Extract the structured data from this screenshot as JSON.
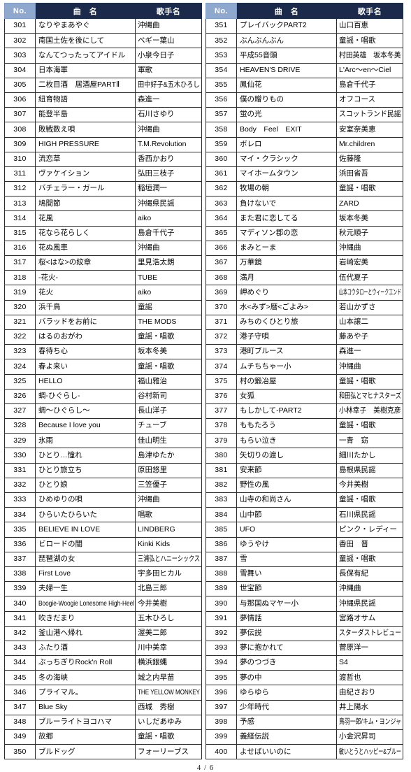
{
  "document": {
    "page_label": "4 / 6",
    "colors": {
      "header_bg": "#1b2a4a",
      "header_no_bg": "#8fa8cd",
      "header_text": "#ffffff",
      "cell_border": "#2b2b2b",
      "page_bg": "#ffffff"
    }
  },
  "tables": [
    {
      "id": "left-table",
      "columns": [
        "No.",
        "曲　名",
        "歌手名"
      ],
      "rows": [
        {
          "no": "301",
          "title": "なりやまあやぐ",
          "artist": "沖縄曲"
        },
        {
          "no": "302",
          "title": "南国土佐を後にして",
          "artist": "ペギー葉山"
        },
        {
          "no": "303",
          "title": "なんてつったってアイドル",
          "artist": "小泉今日子"
        },
        {
          "no": "304",
          "title": "日本海軍",
          "artist": "軍歌"
        },
        {
          "no": "305",
          "title": "二枚目酒　居酒屋PARTⅡ",
          "artist": "田中好子&五木ひろし"
        },
        {
          "no": "306",
          "title": "紐育物語",
          "artist": "森進一"
        },
        {
          "no": "307",
          "title": "能登半島",
          "artist": "石川さゆり"
        },
        {
          "no": "308",
          "title": "敗戦数え唄",
          "artist": "沖縄曲"
        },
        {
          "no": "309",
          "title": "HIGH PRESSURE",
          "artist": "T.M.Revolution"
        },
        {
          "no": "310",
          "title": "流恋草",
          "artist": "香西かおり"
        },
        {
          "no": "311",
          "title": "ヴァケイション",
          "artist": "弘田三枝子"
        },
        {
          "no": "312",
          "title": "バチェラー・ガール",
          "artist": "稲垣潤一"
        },
        {
          "no": "313",
          "title": "鳩間節",
          "artist": "沖縄県民謡"
        },
        {
          "no": "314",
          "title": "花風",
          "artist": "aiko"
        },
        {
          "no": "315",
          "title": "花なら花らしく",
          "artist": "島倉千代子"
        },
        {
          "no": "316",
          "title": "花ぬ風車",
          "artist": "沖縄曲"
        },
        {
          "no": "317",
          "title": "桜<はな>の紋章",
          "artist": "里見浩太朗"
        },
        {
          "no": "318",
          "title": "-花火-",
          "artist": "TUBE"
        },
        {
          "no": "319",
          "title": "花火",
          "artist": "aiko"
        },
        {
          "no": "320",
          "title": "浜千鳥",
          "artist": "童謡"
        },
        {
          "no": "321",
          "title": "バラッドをお前に",
          "artist": "THE MODS"
        },
        {
          "no": "322",
          "title": "はるのおがわ",
          "artist": "童謡・唱歌"
        },
        {
          "no": "323",
          "title": "春待ち心",
          "artist": "坂本冬美"
        },
        {
          "no": "324",
          "title": "春よ来い",
          "artist": "童謡・唱歌"
        },
        {
          "no": "325",
          "title": "HELLO",
          "artist": "福山雅治"
        },
        {
          "no": "326",
          "title": "蜩-ひぐらし-",
          "artist": "谷村新司"
        },
        {
          "no": "327",
          "title": "蜩～ひぐらし～",
          "artist": "長山洋子"
        },
        {
          "no": "328",
          "title": "Because I love you",
          "artist": "チューブ"
        },
        {
          "no": "329",
          "title": "氷雨",
          "artist": "佳山明生"
        },
        {
          "no": "330",
          "title": "ひとり…憧れ",
          "artist": "島津ゆたか"
        },
        {
          "no": "331",
          "title": "ひとり旅立ち",
          "artist": "原田悠里"
        },
        {
          "no": "332",
          "title": "ひとり娘",
          "artist": "三笠優子"
        },
        {
          "no": "333",
          "title": "ひめゆりの唄",
          "artist": "沖縄曲"
        },
        {
          "no": "334",
          "title": "ひらいたひらいた",
          "artist": "唱歌"
        },
        {
          "no": "335",
          "title": "BELIEVE IN LOVE",
          "artist": "LINDBERG"
        },
        {
          "no": "336",
          "title": "ビロードの闇",
          "artist": "Kinki Kids"
        },
        {
          "no": "337",
          "title": "琵琶湖の女",
          "artist": "三浦弘とハニーシックス"
        },
        {
          "no": "338",
          "title": "First Love",
          "artist": "宇多田ヒカル"
        },
        {
          "no": "339",
          "title": "夫婦一生",
          "artist": "北島三郎"
        },
        {
          "no": "340",
          "title": "Boogie-Woogie Lonesome High-Heel",
          "artist": "今井美樹"
        },
        {
          "no": "341",
          "title": "吹きだまり",
          "artist": "五木ひろし"
        },
        {
          "no": "342",
          "title": "釜山港へ帰れ",
          "artist": "渥美二郎"
        },
        {
          "no": "343",
          "title": "ふたり酒",
          "artist": "川中美幸"
        },
        {
          "no": "344",
          "title": "ぶっちぎりRock'n Roll",
          "artist": "横浜銀蝿"
        },
        {
          "no": "345",
          "title": "冬の海峡",
          "artist": "城之内早苗"
        },
        {
          "no": "346",
          "title": "プライマル。",
          "artist": "THE YELLOW MONKEY"
        },
        {
          "no": "347",
          "title": "Blue Sky",
          "artist": "西城　秀樹"
        },
        {
          "no": "348",
          "title": "ブルーライトヨコハマ",
          "artist": "いしだあゆみ"
        },
        {
          "no": "349",
          "title": "故郷",
          "artist": "童謡・唱歌"
        },
        {
          "no": "350",
          "title": "ブルドッグ",
          "artist": "フォーリーブス"
        }
      ]
    },
    {
      "id": "right-table",
      "columns": [
        "No.",
        "曲　名",
        "歌手名"
      ],
      "rows": [
        {
          "no": "351",
          "title": "プレイバックPART2",
          "artist": "山口百恵"
        },
        {
          "no": "352",
          "title": "ぶんぶんぶん",
          "artist": "童謡・唱歌"
        },
        {
          "no": "353",
          "title": "平成55音頭",
          "artist": "村田英雄　坂本冬美"
        },
        {
          "no": "354",
          "title": "HEAVEN'S DRIVE",
          "artist": "L'Arc～en～Ciel"
        },
        {
          "no": "355",
          "title": "鳳仙花",
          "artist": "島倉千代子"
        },
        {
          "no": "356",
          "title": "僕の贈りもの",
          "artist": "オフコース"
        },
        {
          "no": "357",
          "title": "蛍の光",
          "artist": "スコットランド民謡"
        },
        {
          "no": "358",
          "title": "Body　Feel　EXIT",
          "artist": "安室奈美恵"
        },
        {
          "no": "359",
          "title": "ボレロ",
          "artist": "Mr.children"
        },
        {
          "no": "360",
          "title": "マイ・クラシック",
          "artist": "佐藤隆"
        },
        {
          "no": "361",
          "title": "マイホームタウン",
          "artist": "浜田省吾"
        },
        {
          "no": "362",
          "title": "牧場の朝",
          "artist": "童謡・唱歌"
        },
        {
          "no": "363",
          "title": "負けないで",
          "artist": "ZARD"
        },
        {
          "no": "364",
          "title": "また君に恋してる",
          "artist": "坂本冬美"
        },
        {
          "no": "365",
          "title": "マディソン郡の恋",
          "artist": "秋元順子"
        },
        {
          "no": "366",
          "title": "まみとーま",
          "artist": "沖縄曲"
        },
        {
          "no": "367",
          "title": "万華鏡",
          "artist": "岩崎宏美"
        },
        {
          "no": "368",
          "title": "満月",
          "artist": "伍代夏子"
        },
        {
          "no": "369",
          "title": "岬めぐり",
          "artist": "山本コウタローとウィークエンド"
        },
        {
          "no": "370",
          "title": "水<みず>暦<ごよみ>",
          "artist": "若山かずさ"
        },
        {
          "no": "371",
          "title": "みちのくひとり旅",
          "artist": "山本譲二"
        },
        {
          "no": "372",
          "title": "港子守唄",
          "artist": "藤あや子"
        },
        {
          "no": "373",
          "title": "港町ブルース",
          "artist": "森進一"
        },
        {
          "no": "374",
          "title": "ムチちちゃー小",
          "artist": "沖縄曲"
        },
        {
          "no": "375",
          "title": "村の鍛冶屋",
          "artist": "童謡・唱歌"
        },
        {
          "no": "376",
          "title": "女狐",
          "artist": "和田弘とマヒナスターズ"
        },
        {
          "no": "377",
          "title": "もしかして-PART2",
          "artist": "小林幸子　美樹克彦"
        },
        {
          "no": "378",
          "title": "ももたろう",
          "artist": "童謡・唱歌"
        },
        {
          "no": "379",
          "title": "もらい泣き",
          "artist": "一青　窈"
        },
        {
          "no": "380",
          "title": "矢切りの渡し",
          "artist": "細川たかし"
        },
        {
          "no": "381",
          "title": "安来節",
          "artist": "島根県民謡"
        },
        {
          "no": "382",
          "title": "野性の風",
          "artist": "今井美樹"
        },
        {
          "no": "383",
          "title": "山寺の和尚さん",
          "artist": "童謡・唱歌"
        },
        {
          "no": "384",
          "title": "山中節",
          "artist": "石川県民謡"
        },
        {
          "no": "385",
          "title": "UFO",
          "artist": "ピンク・レディー"
        },
        {
          "no": "386",
          "title": "ゆうやけ",
          "artist": "香田　晋"
        },
        {
          "no": "387",
          "title": "雪",
          "artist": "童謡・唱歌"
        },
        {
          "no": "388",
          "title": "雪舞い",
          "artist": "長保有紀"
        },
        {
          "no": "389",
          "title": "世宝節",
          "artist": "沖縄曲"
        },
        {
          "no": "390",
          "title": "与那国ぬマヤー小",
          "artist": "沖縄県民謡"
        },
        {
          "no": "391",
          "title": "夢情話",
          "artist": "宮路オサム"
        },
        {
          "no": "392",
          "title": "夢伝説",
          "artist": "スターダストレビュー"
        },
        {
          "no": "393",
          "title": "夢に抱かれて",
          "artist": "菅原洋一"
        },
        {
          "no": "394",
          "title": "夢のつづき",
          "artist": "S4"
        },
        {
          "no": "395",
          "title": "夢の中",
          "artist": "渡哲也"
        },
        {
          "no": "396",
          "title": "ゆらゆら",
          "artist": "由紀さおり"
        },
        {
          "no": "397",
          "title": "少年時代",
          "artist": "井上陽水"
        },
        {
          "no": "398",
          "title": "予感",
          "artist": "鳥羽一郎/キム・ヨンジャ"
        },
        {
          "no": "399",
          "title": "義経伝説",
          "artist": "小金沢昇司"
        },
        {
          "no": "400",
          "title": "よせばいいのに",
          "artist": "敏いとうとハッピー&ブルー"
        }
      ]
    }
  ]
}
